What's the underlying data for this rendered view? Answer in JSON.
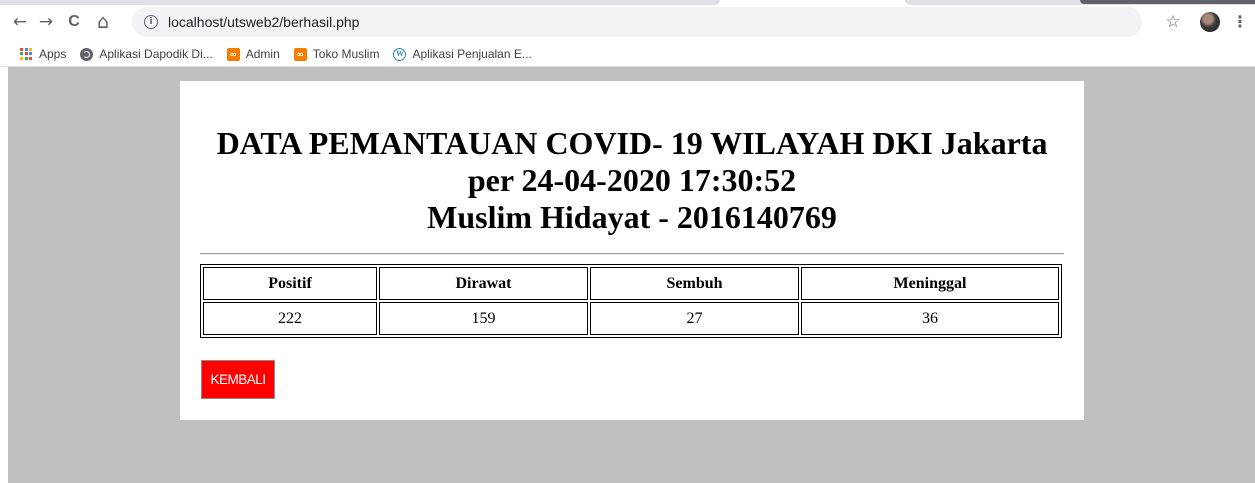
{
  "browser": {
    "url": "localhost/utsweb2/berhasil.php",
    "nav": {
      "back_glyph": "←",
      "forward_glyph": "→",
      "reload_glyph": "C",
      "home_glyph": "⌂"
    },
    "star_glyph": "☆",
    "menu_glyph": "⋮",
    "bookmarks": [
      {
        "label": "Apps",
        "icon": "apps-icon"
      },
      {
        "label": "Aplikasi Dapodik Di...",
        "icon": "globe-icon"
      },
      {
        "label": "Admin",
        "icon": "xampp-icon"
      },
      {
        "label": "Toko Muslim",
        "icon": "xampp-icon"
      },
      {
        "label": "Aplikasi Penjualan E...",
        "icon": "wordpress-icon"
      }
    ]
  },
  "page": {
    "title_line1": "DATA PEMANTAUAN COVID- 19 WILAYAH DKI Jakarta",
    "title_line2": "per 24-04-2020 17:30:52",
    "title_line3": "Muslim Hidayat - 2016140769",
    "table": {
      "headers": [
        "Positif",
        "Dirawat",
        "Sembuh",
        "Meninggal"
      ],
      "rows": [
        [
          "222",
          "159",
          "27",
          "36"
        ]
      ]
    },
    "back_button_label": "KEMBALI"
  },
  "colors": {
    "page_background": "#c0c0c0",
    "back_button": "#ff0000"
  }
}
